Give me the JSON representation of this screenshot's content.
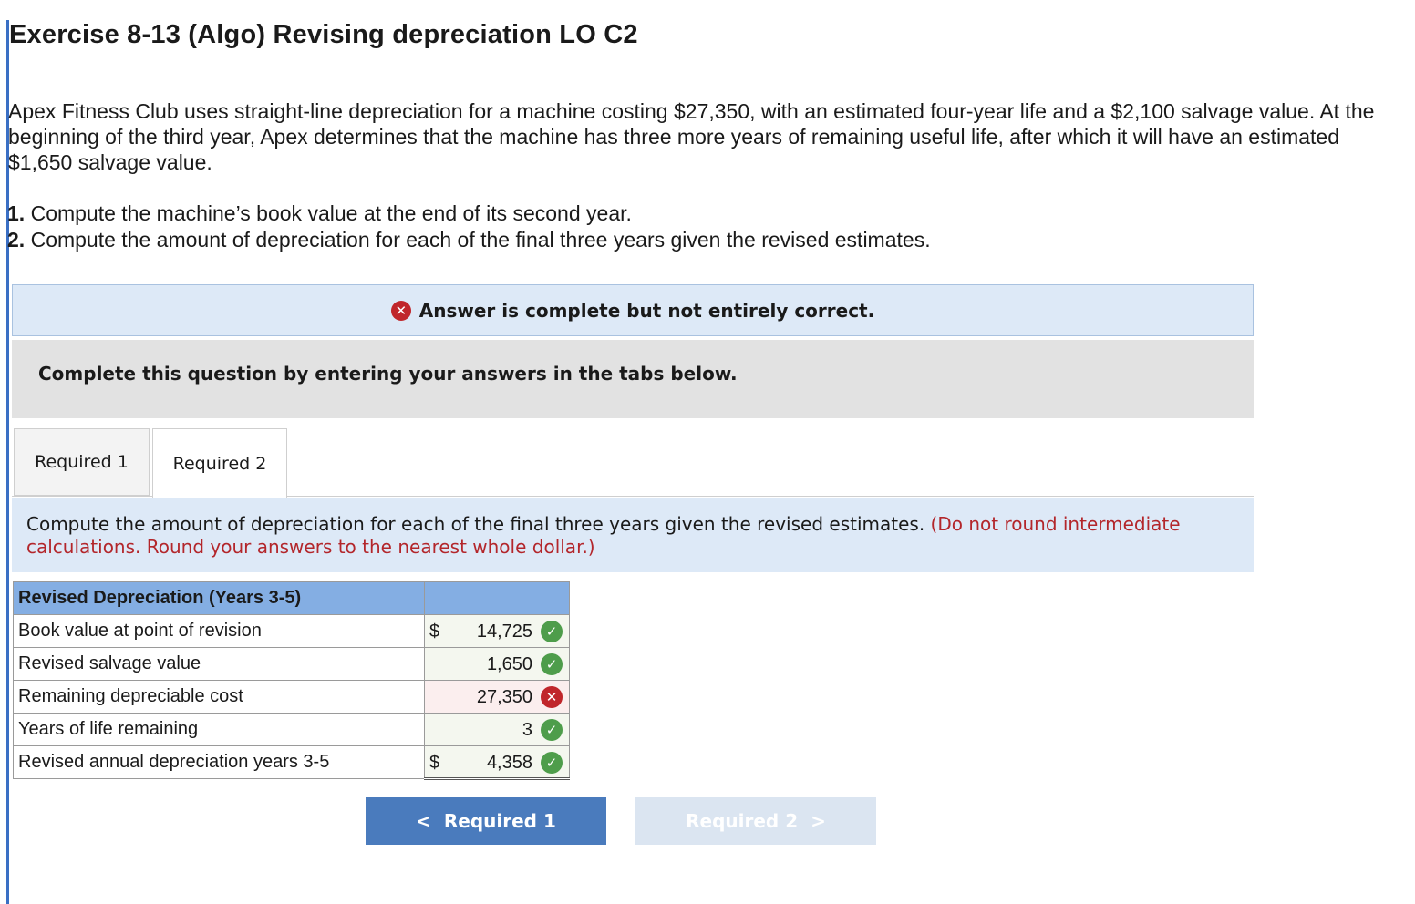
{
  "title": "Exercise 8-13 (Algo) Revising depreciation LO C2",
  "intro": "Apex Fitness Club uses straight-line depreciation for a machine costing $27,350, with an estimated four-year life and a $2,100 salvage value. At the beginning of the third year, Apex determines that the machine has three more years of remaining useful life, after which it will have an estimated $1,650 salvage value.",
  "requirements": [
    {
      "num": "1.",
      "text": "Compute the machine’s book value at the end of its second year."
    },
    {
      "num": "2.",
      "text": "Compute the amount of depreciation for each of the final three years given the revised estimates."
    }
  ],
  "banner": {
    "icon": "x-circle-icon",
    "text": "Answer is complete but not entirely correct."
  },
  "instruction": "Complete this question by entering your answers in the tabs below.",
  "tabs": [
    {
      "label": "Required 1",
      "active": false
    },
    {
      "label": "Required 2",
      "active": true
    }
  ],
  "prompt": {
    "text": "Compute the amount of depreciation for each of the final three years given the revised estimates.",
    "hint": "(Do not round intermediate calculations. Round your answers to the nearest whole dollar.)"
  },
  "table": {
    "header": "Revised Depreciation (Years 3-5)",
    "rows": [
      {
        "label": "Book value at point of revision",
        "dollar": "$",
        "value": "14,725",
        "status": "correct"
      },
      {
        "label": "Revised salvage value",
        "dollar": "",
        "value": "1,650",
        "status": "correct"
      },
      {
        "label": "Remaining depreciable cost",
        "dollar": "",
        "value": "27,350",
        "status": "incorrect"
      },
      {
        "label": "Years of life remaining",
        "dollar": "",
        "value": "3",
        "status": "correct"
      },
      {
        "label": "Revised annual depreciation years 3-5",
        "dollar": "$",
        "value": "4,358",
        "status": "correct"
      }
    ]
  },
  "nav": {
    "prev_label": "Required 1",
    "next_label": "Required 2"
  },
  "colors": {
    "correct": "#4e9d4b",
    "incorrect": "#c0262b",
    "header_fill": "#84aee3",
    "nav_active": "#4a7bbd"
  }
}
